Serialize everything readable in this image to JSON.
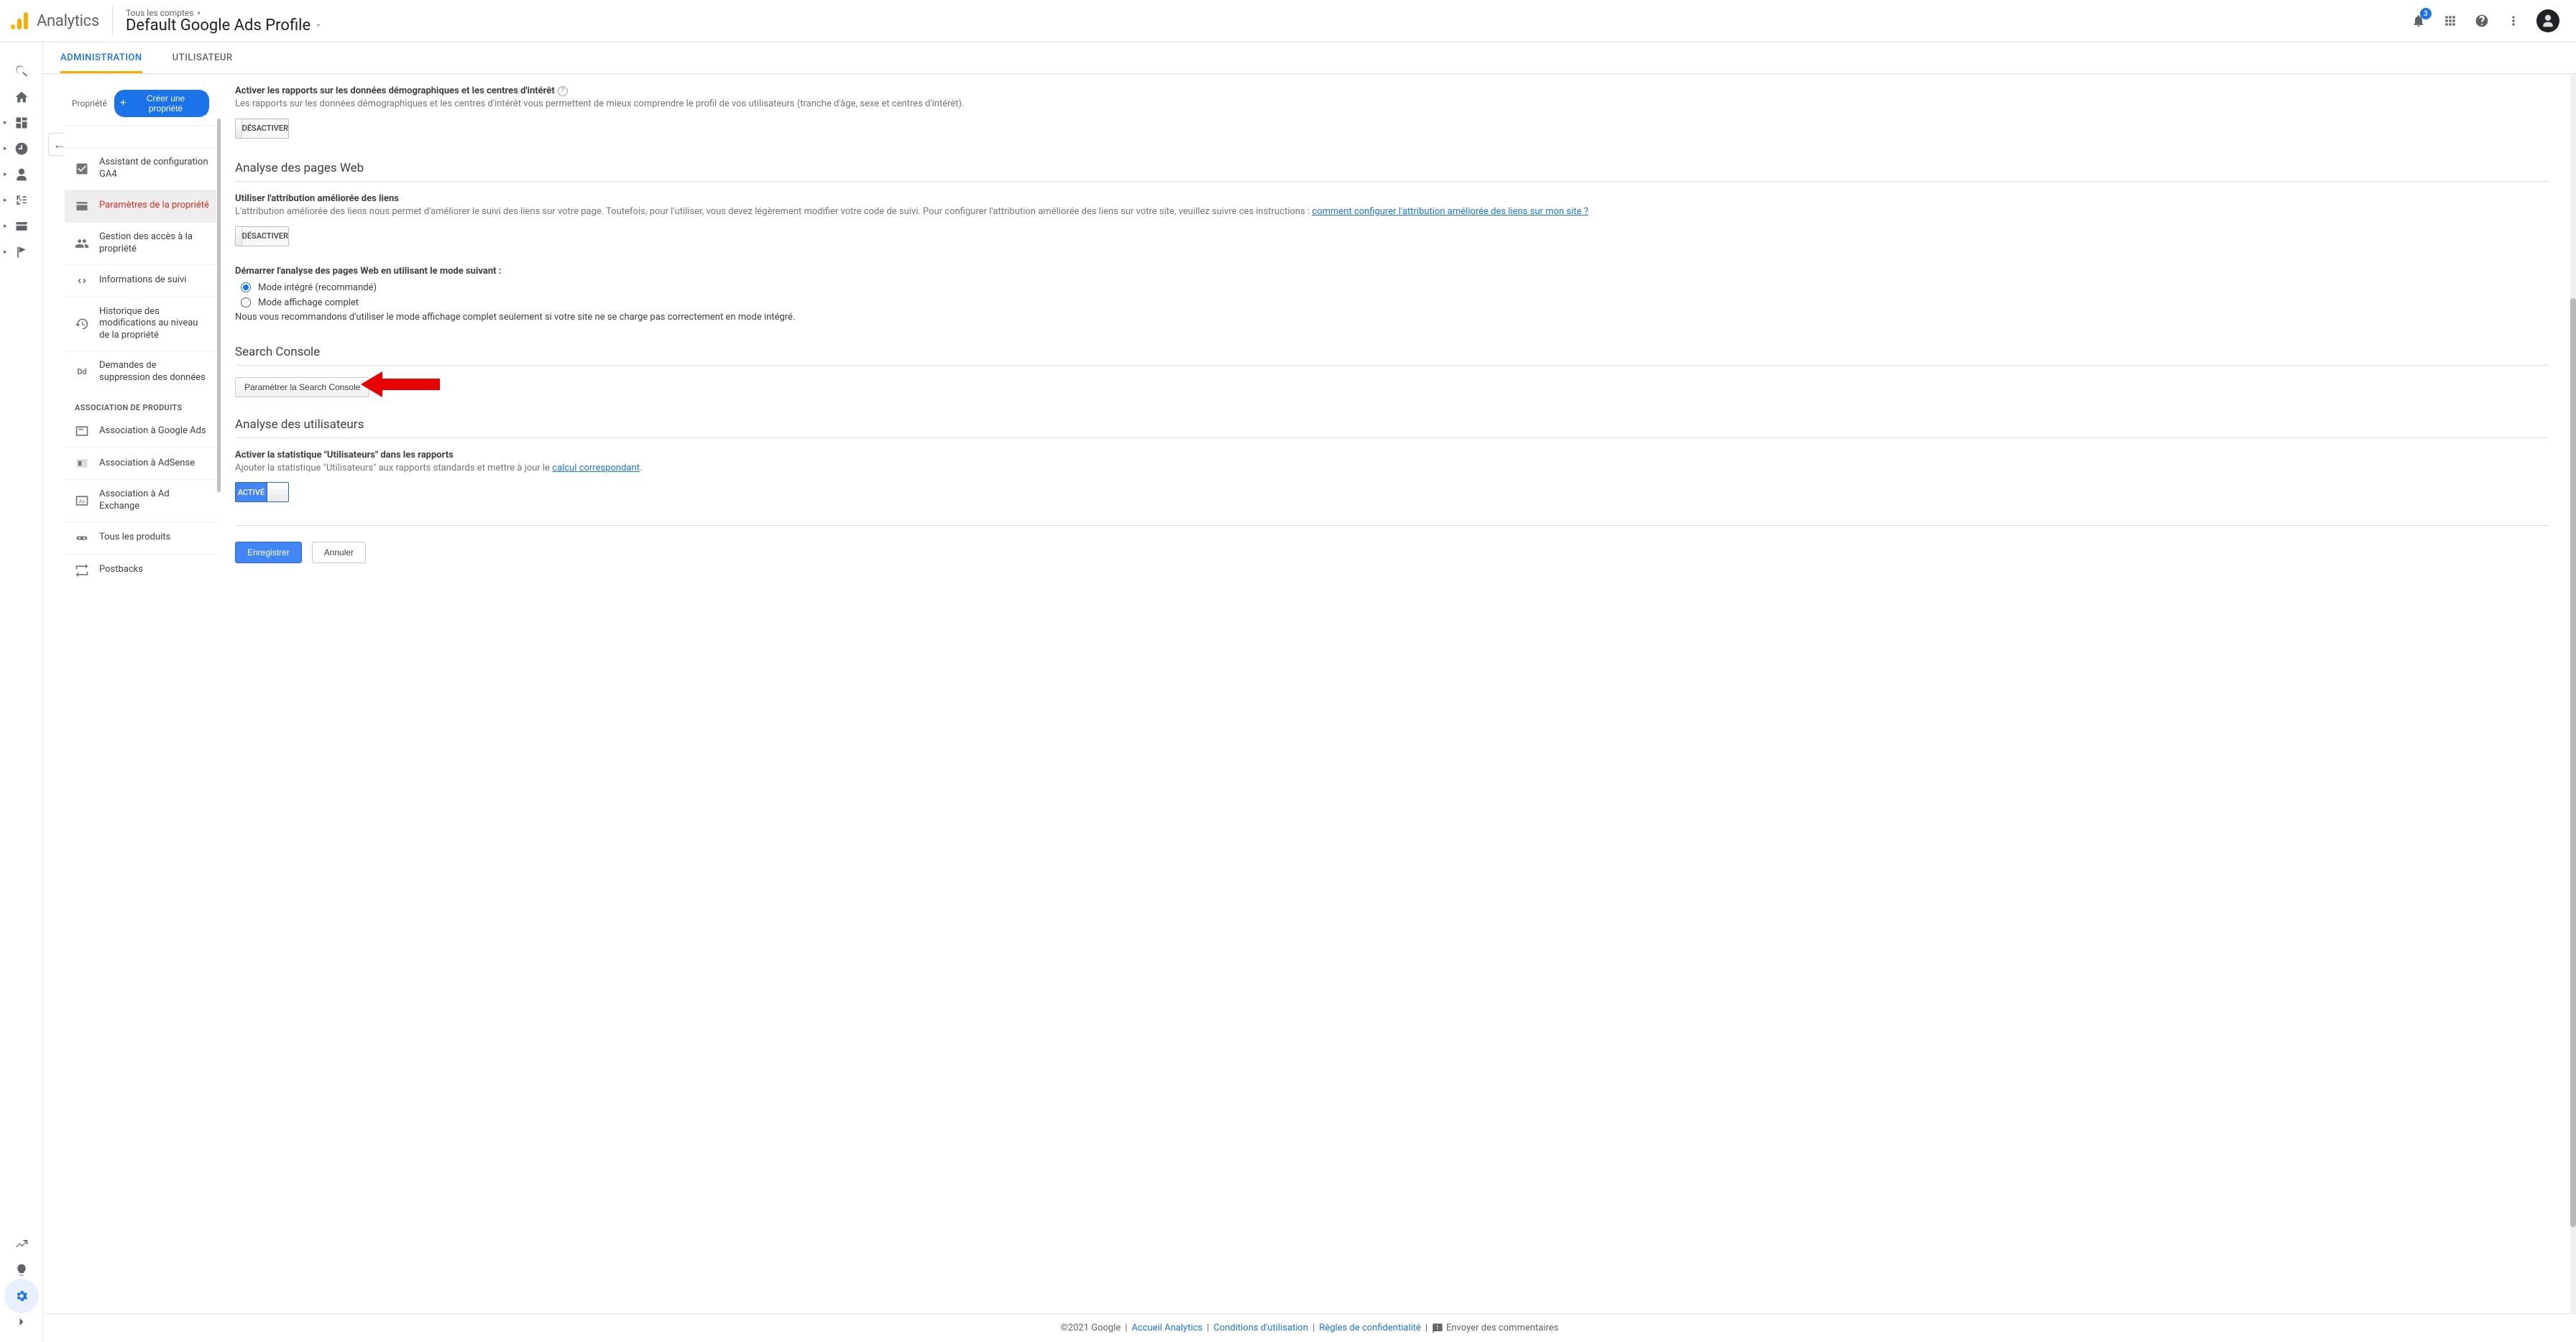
{
  "header": {
    "product": "Analytics",
    "all_accounts": "Tous les comptes",
    "profile": "Default Google Ads Profile",
    "notif_count": "3"
  },
  "tabs": {
    "admin": "ADMINISTRATION",
    "user": "UTILISATEUR"
  },
  "property_pane": {
    "label": "Propriété",
    "create": "Créer une propriété",
    "items": [
      "Assistant de configuration GA4",
      "Paramètres de la propriété",
      "Gestion des accès à la propriété",
      "Informations de suivi",
      "Historique des modifications au niveau de la propriété",
      "Demandes de suppression des données"
    ],
    "section": "ASSOCIATION DE PRODUITS",
    "assoc": [
      "Association à Google Ads",
      "Association à AdSense",
      "Association à Ad Exchange",
      "Tous les produits",
      "Postbacks"
    ]
  },
  "settings": {
    "demog": {
      "title": "Activer les rapports sur les données démographiques et les centres d'intérêt",
      "desc": "Les rapports sur les données démographiques et les centres d'intérêt vous permettent de mieux comprendre le profil de vos utilisateurs (tranche d'âge, sexe et centres d'intérêt).",
      "toggle": "DÉSACTIVER"
    },
    "inpage_heading": "Analyse des pages Web",
    "enhanced": {
      "title": "Utiliser l'attribution améliorée des liens",
      "desc_a": "L'attribution améliorée des liens nous permet d'améliorer le suivi des liens sur votre page. Toutefois, pour l'utiliser, vous devez légèrement modifier votre code de suivi. Pour configurer l'attribution améliorée des liens sur votre site, veuillez suivre ces instructions : ",
      "link": "comment configurer l'attribution améliorée des liens sur mon site ?",
      "toggle": "DÉSACTIVER"
    },
    "start_mode": {
      "title": "Démarrer l'analyse des pages Web en utilisant le mode suivant :",
      "opt1": "Mode intégré (recommandé)",
      "opt2": "Mode affichage complet",
      "note": "Nous vous recommandons d'utiliser le mode affichage complet seulement si votre site ne se charge pas correctement en mode intégré."
    },
    "sc_heading": "Search Console",
    "sc_button": "Paramétrer la Search Console",
    "user_heading": "Analyse des utilisateurs",
    "usermetric": {
      "title": "Activer la statistique \"Utilisateurs\" dans les rapports",
      "desc_a": "Ajouter la statistique \"Utilisateurs\" aux rapports standards et mettre à jour le ",
      "link": "calcul correspondant",
      "toggle": "ACTIVÉ"
    },
    "save": "Enregistrer",
    "cancel": "Annuler"
  },
  "footer": {
    "copyright": "©2021 Google",
    "home": "Accueil Analytics",
    "tos": "Conditions d'utilisation",
    "privacy": "Règles de confidentialité",
    "feedback": "Envoyer des commentaires"
  }
}
